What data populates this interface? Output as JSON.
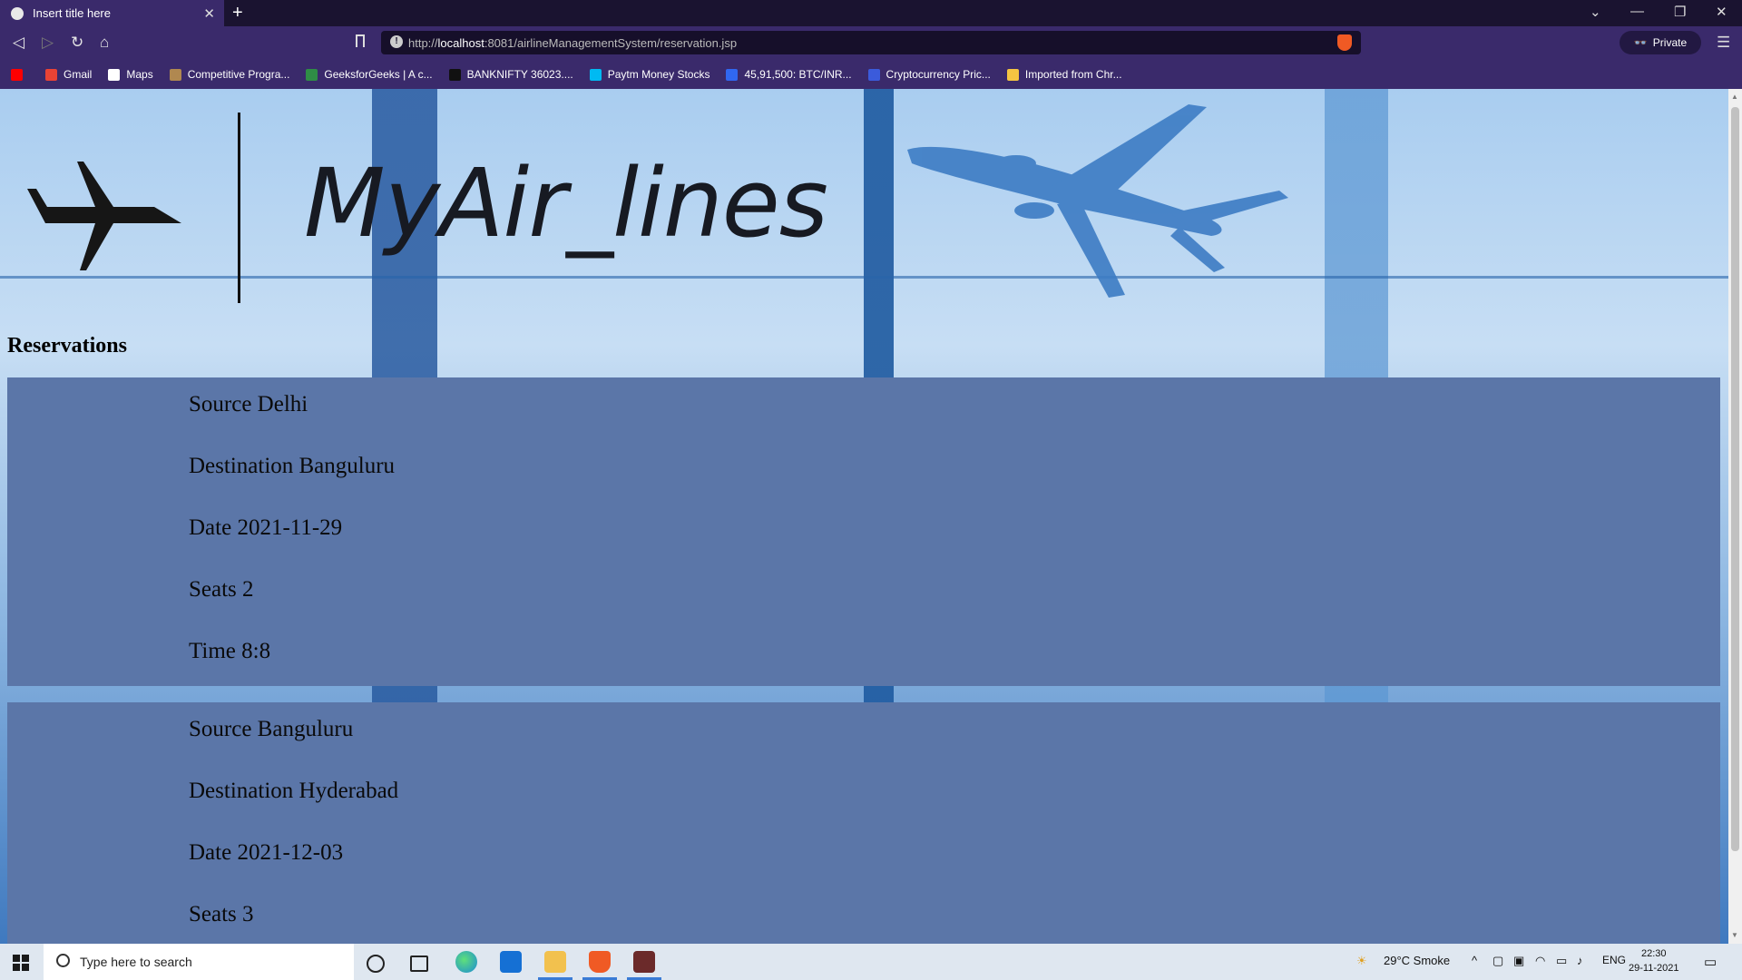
{
  "browser": {
    "tab_title": "Insert title here",
    "tab_close": "✕",
    "new_tab": "+",
    "url_prefix": "http://",
    "url_host": "localhost",
    "url_rest": ":8081/airlineManagementSystem/reservation.jsp",
    "private_label": "Private",
    "bookmarks": [
      {
        "label": "",
        "icon": "youtube-icon",
        "color": "#ff0000"
      },
      {
        "label": "Gmail",
        "icon": "gmail-icon",
        "color": "#ea4335"
      },
      {
        "label": "Maps",
        "icon": "google-icon",
        "color": "#ffffff"
      },
      {
        "label": "Competitive Progra...",
        "icon": "cc-icon",
        "color": "#b08850"
      },
      {
        "label": "GeeksforGeeks | A c...",
        "icon": "gfg-icon",
        "color": "#2f8d46"
      },
      {
        "label": "BANKNIFTY 36023....",
        "icon": "tradingview-icon",
        "color": "#111111"
      },
      {
        "label": "Paytm Money Stocks",
        "icon": "paytm-icon",
        "color": "#00baf2"
      },
      {
        "label": "45,91,500: BTC/INR...",
        "icon": "wazirx-icon",
        "color": "#3067f0"
      },
      {
        "label": "Cryptocurrency Pric...",
        "icon": "coingecko-icon",
        "color": "#3b5bdb"
      },
      {
        "label": "Imported from Chr...",
        "icon": "folder-icon",
        "color": "#f5c542"
      }
    ]
  },
  "page": {
    "logo_text": "MyAir_lines",
    "section_title": "Reservations",
    "reservations": [
      {
        "source": "Source Delhi",
        "destination": "Destination Banguluru",
        "date": "Date 2021-11-29",
        "seats": "Seats 2",
        "time": "Time 8:8"
      },
      {
        "source": "Source Banguluru",
        "destination": "Destination Hyderabad",
        "date": "Date 2021-12-03",
        "seats": "Seats 3",
        "time": ""
      }
    ],
    "card_color": "#5b76a8"
  },
  "taskbar": {
    "search_placeholder": "Type here to search",
    "weather": "29°C  Smoke",
    "language": "ENG",
    "time": "22:30",
    "date": "29-11-2021"
  }
}
